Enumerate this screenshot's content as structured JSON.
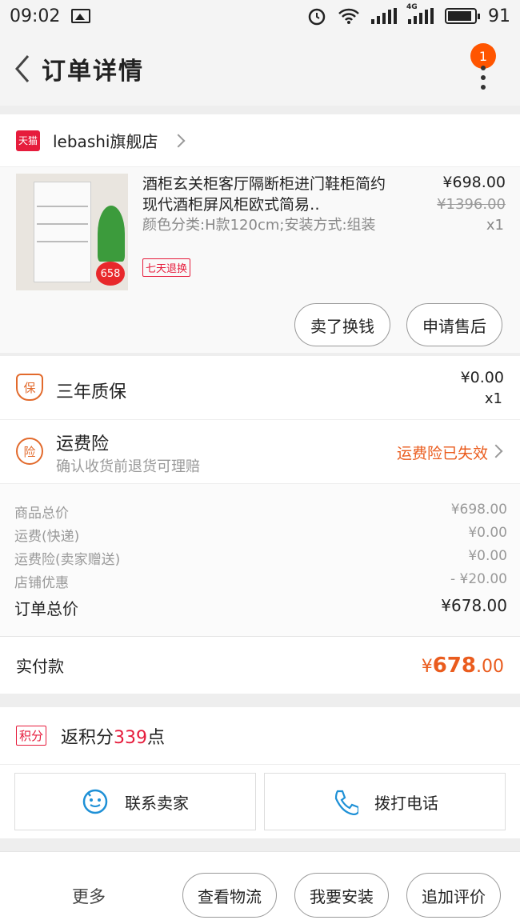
{
  "status_bar": {
    "time": "09:02",
    "battery": "91",
    "network": "4G"
  },
  "nav": {
    "title": "订单详情",
    "badge_count": "1"
  },
  "shop": {
    "logo_text": "天猫",
    "name": "lebashi旗舰店"
  },
  "product": {
    "title": "酒柜玄关柜客厅隔断柜进门鞋柜简约现代酒柜屏风柜欧式简易‥",
    "spec": "颜色分类:H款120cm;安装方式:组装",
    "tag": "七天退换",
    "price": "¥698.00",
    "original_price": "¥1396.00",
    "qty": "x1",
    "thumb_price": "658",
    "actions": [
      "卖了换钱",
      "申请售后"
    ]
  },
  "warranty": {
    "icon_text": "保",
    "title": "三年质保",
    "price": "¥0.00",
    "qty": "x1"
  },
  "freight_insurance": {
    "icon_text": "险",
    "title": "运费险",
    "subtitle": "确认收货前退货可理赔",
    "status": "运费险已失效"
  },
  "summary": {
    "rows": [
      {
        "label": "商品总价",
        "value": "¥698.00"
      },
      {
        "label": "运费(快递)",
        "value": "¥0.00"
      },
      {
        "label": "运费险(卖家赠送)",
        "value": "¥0.00"
      },
      {
        "label": "店铺优惠",
        "value": "- ¥20.00"
      }
    ],
    "total_label": "订单总价",
    "total_value": "¥678.00"
  },
  "paid": {
    "label": "实付款",
    "currency": "¥",
    "amount_int": "678",
    "amount_dec": ".00"
  },
  "points": {
    "tag": "积分",
    "prefix": "返积分",
    "value": "339",
    "suffix": "点"
  },
  "contact": {
    "seller": "联系卖家",
    "phone": "拨打电话"
  },
  "bottom_bar": {
    "more": "更多",
    "buttons": [
      "查看物流",
      "我要安装",
      "追加评价"
    ]
  },
  "colors": {
    "accent": "#ea5c1e",
    "tmall_red": "#e61c3c",
    "badge": "#ff5500",
    "link_blue": "#1e90d6"
  }
}
